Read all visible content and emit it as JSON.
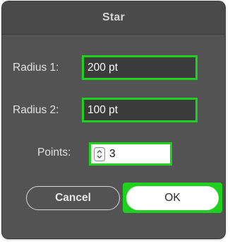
{
  "dialog": {
    "title": "Star"
  },
  "fields": {
    "radius1": {
      "label": "Radius 1:",
      "value": "200 pt"
    },
    "radius2": {
      "label": "Radius 2:",
      "value": "100 pt"
    },
    "points": {
      "label": "Points:",
      "value": "3"
    }
  },
  "buttons": {
    "cancel_label": "Cancel",
    "ok_label": "OK"
  },
  "colors": {
    "highlight": "#1fd11f",
    "dialog_bg": "#535353"
  },
  "icons": {
    "stepper": "up-down-stepper-icon"
  }
}
